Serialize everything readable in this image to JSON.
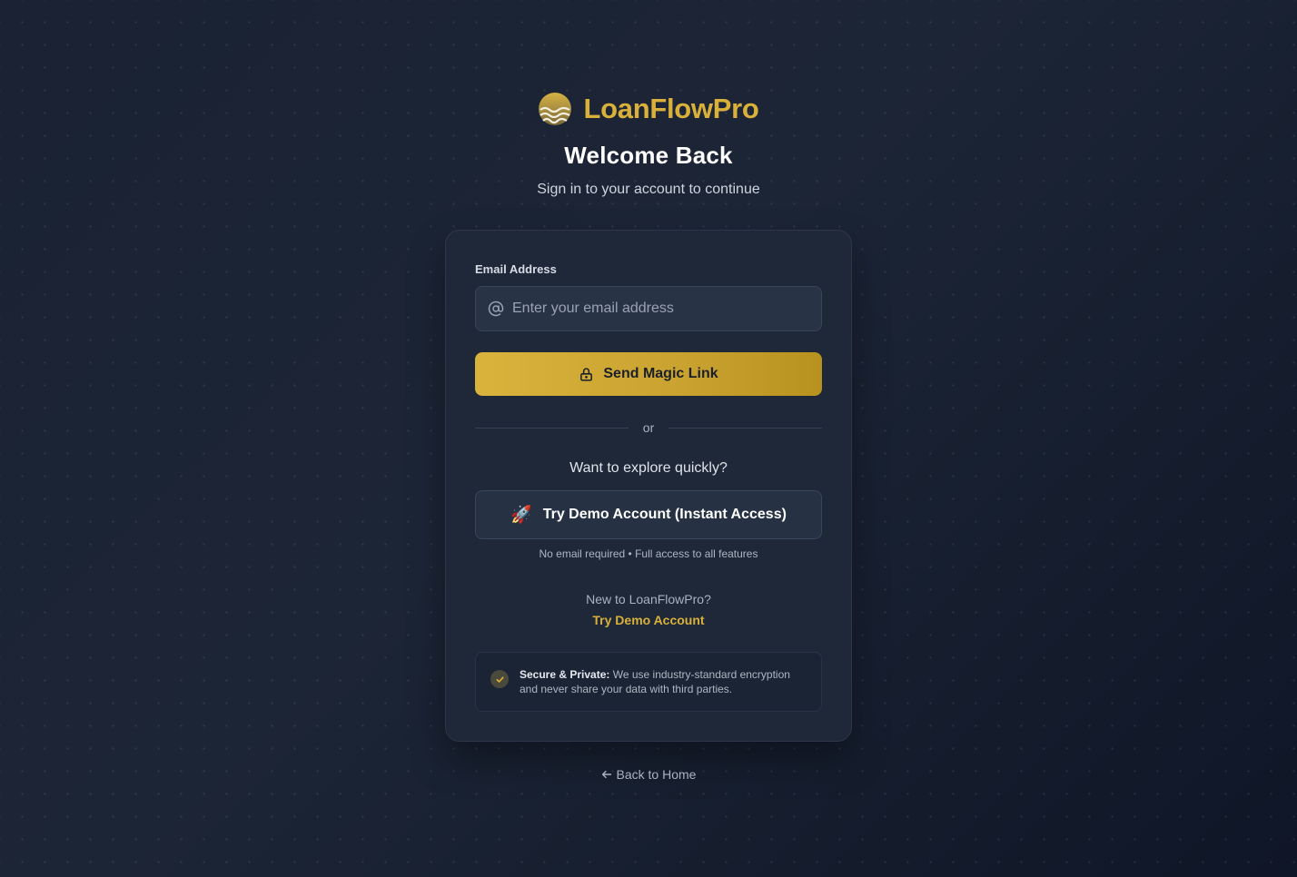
{
  "brand": {
    "name": "LoanFlowPro",
    "logo_icon": "waves-logo-icon",
    "color": "#d9b13a"
  },
  "header": {
    "title": "Welcome Back",
    "subtitle": "Sign in to your account to continue"
  },
  "form": {
    "email_label": "Email Address",
    "email_placeholder": "Enter your email address",
    "email_value": "",
    "email_icon": "at-sign-icon",
    "submit_label": "Send Magic Link",
    "submit_icon": "lock-icon",
    "divider_text": "or"
  },
  "demo": {
    "prompt": "Want to explore quickly?",
    "button_label": "Try Demo Account (Instant Access)",
    "button_icon": "🚀",
    "note": "No email required • Full access to all features"
  },
  "signup": {
    "question": "New to LoanFlowPro?",
    "link_label": "Try Demo Account"
  },
  "security": {
    "title": "Secure & Private:",
    "text": " We use industry-standard encryption and never share your data with third parties.",
    "icon": "check-icon"
  },
  "footer": {
    "back_label": "Back to Home",
    "back_icon": "arrow-left-icon"
  },
  "colors": {
    "accent": "#d9b13a",
    "background": "#1c2536",
    "card": "#1e2838"
  }
}
